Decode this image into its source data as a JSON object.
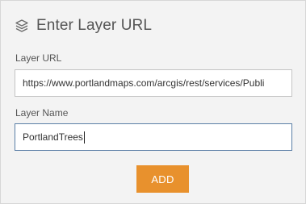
{
  "dialog": {
    "title": "Enter Layer URL",
    "title_icon": "layers-icon"
  },
  "layer_url": {
    "label": "Layer URL",
    "value": "https://www.portlandmaps.com/arcgis/rest/services/Publi"
  },
  "layer_name": {
    "label": "Layer Name",
    "value": "PortlandTrees"
  },
  "add_button": {
    "label": "ADD"
  },
  "colors": {
    "accent": "#e8912d",
    "panel_background": "#f3f3f3",
    "focus_border": "#5b7fa6"
  }
}
